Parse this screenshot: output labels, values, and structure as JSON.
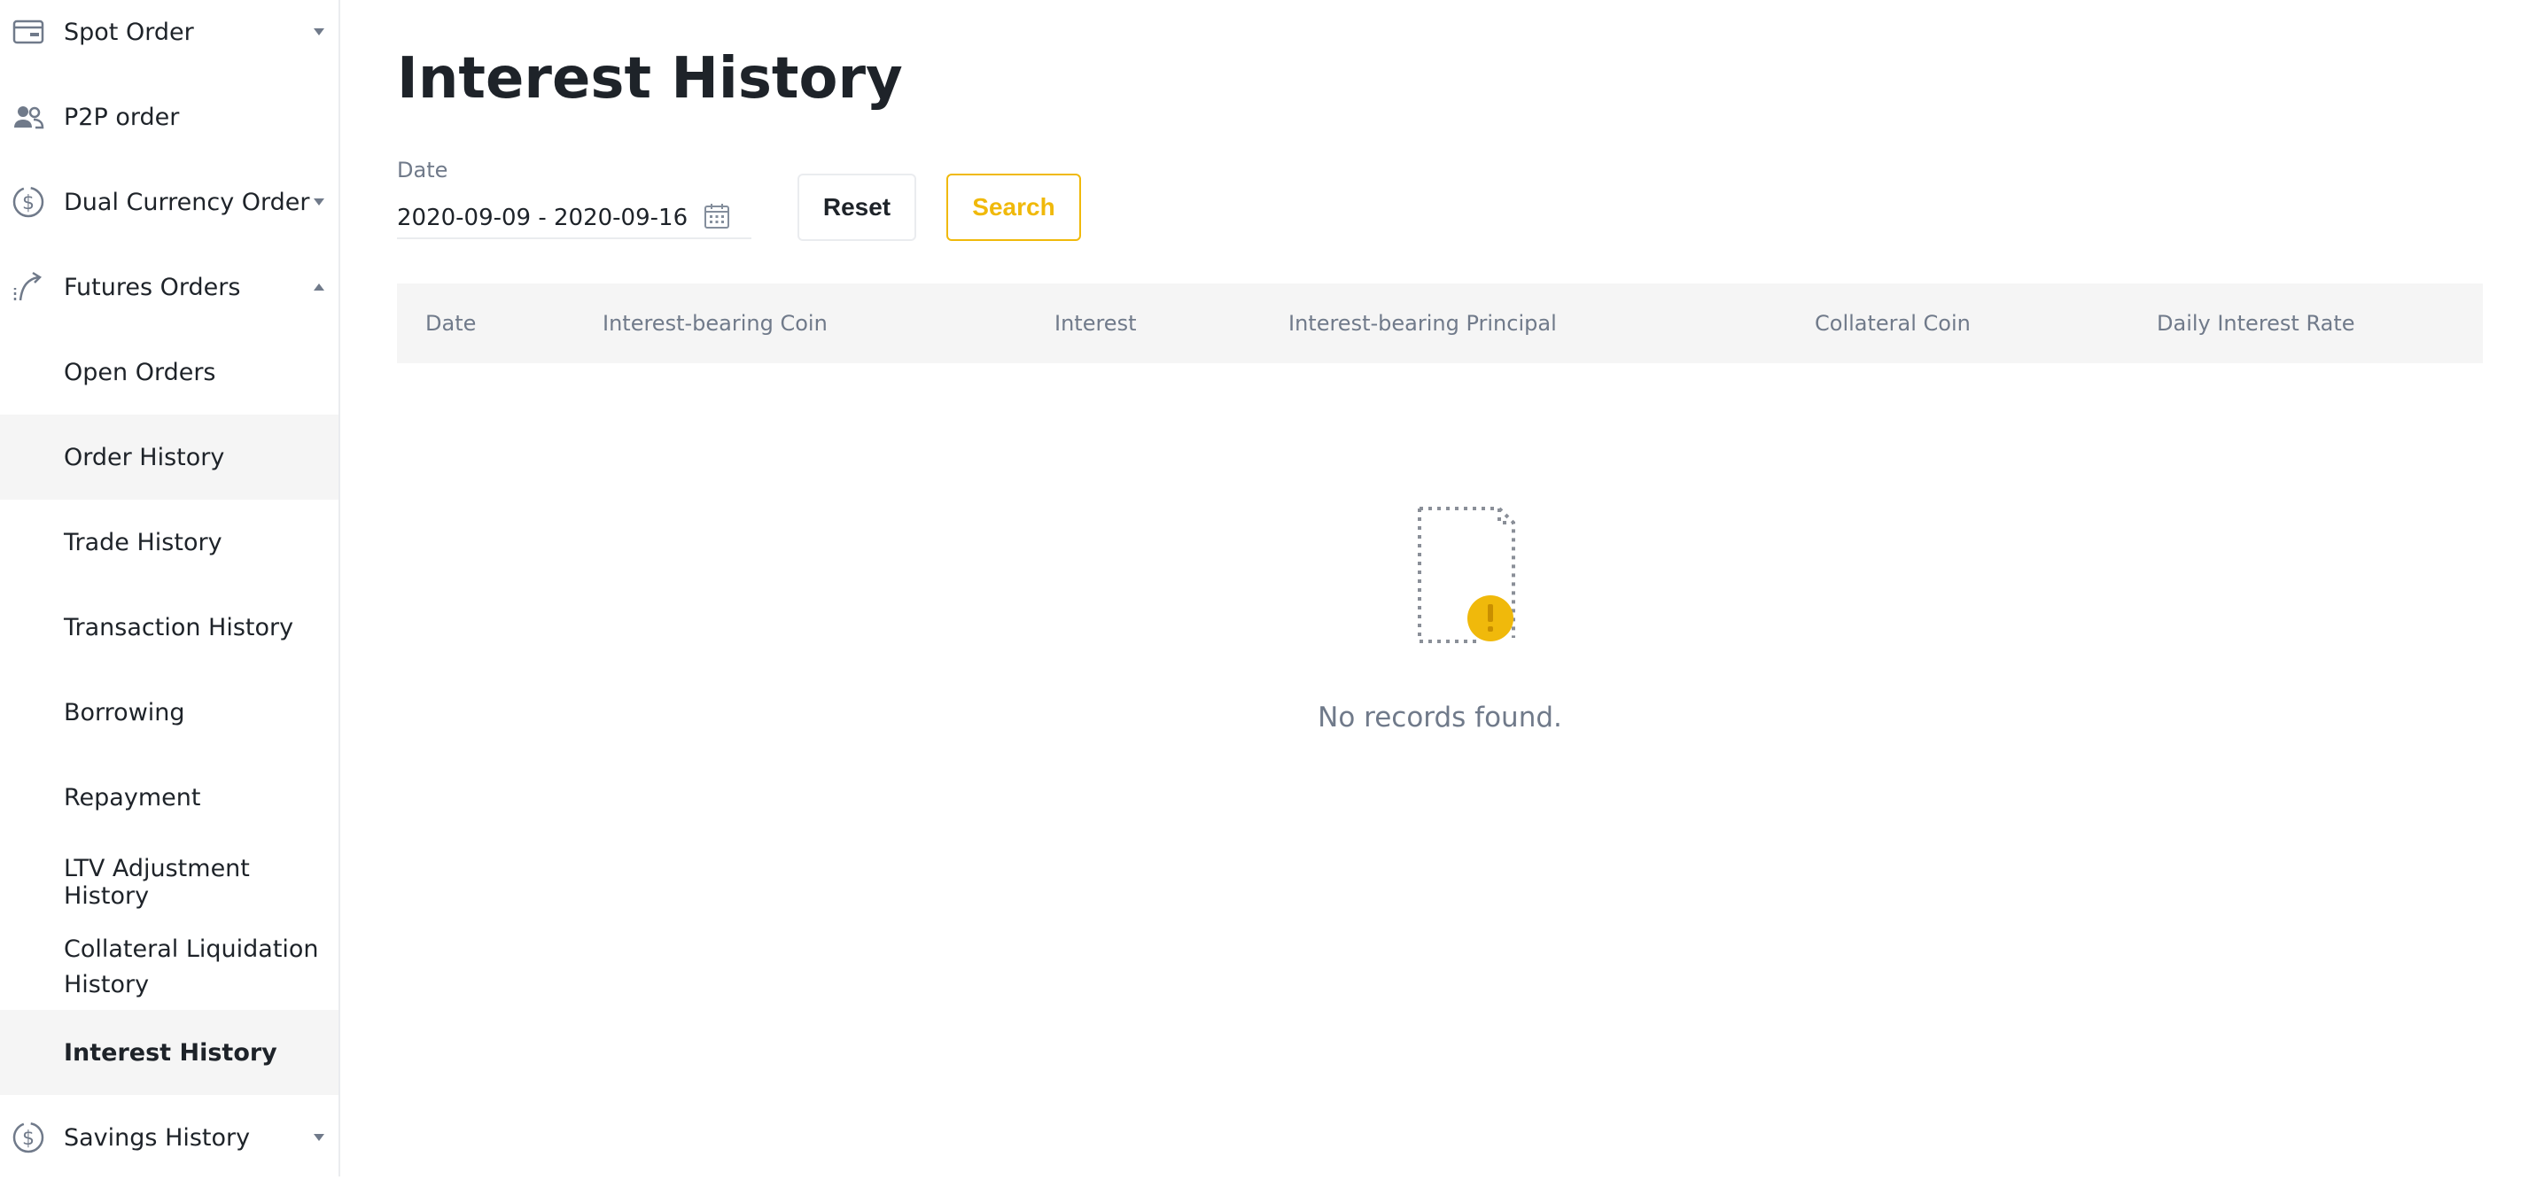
{
  "sidebar": {
    "items": [
      {
        "label": "Spot Order",
        "icon": "wallet-card-icon"
      },
      {
        "label": "P2P order",
        "icon": "users-icon"
      },
      {
        "label": "Dual Currency Order",
        "icon": "dollar-circle-icon"
      },
      {
        "label": "Futures Orders",
        "icon": "futures-arrow-icon"
      },
      {
        "label": "Open Orders"
      },
      {
        "label": "Order History"
      },
      {
        "label": "Trade History"
      },
      {
        "label": "Transaction History"
      },
      {
        "label": "Borrowing"
      },
      {
        "label": "Repayment"
      },
      {
        "label": "LTV Adjustment History"
      },
      {
        "label": "Collateral Liquidation History"
      },
      {
        "label": "Interest History"
      },
      {
        "label": "Savings History",
        "icon": "dollar-circle-icon"
      }
    ]
  },
  "main": {
    "title": "Interest History",
    "filter": {
      "date_label": "Date",
      "date_value": "2020-09-09 - 2020-09-16",
      "reset_label": "Reset",
      "search_label": "Search"
    },
    "table": {
      "columns": [
        "Date",
        "Interest-bearing Coin",
        "Interest",
        "Interest-bearing Principal",
        "Collateral Coin",
        "Daily Interest Rate"
      ]
    },
    "empty": {
      "message": "No records found.",
      "icon": "empty-document-warning-icon"
    }
  },
  "colors": {
    "accent": "#f0b90b",
    "text_primary": "#1e2329",
    "text_secondary": "#707a8a",
    "active_bg": "#f5f5f5"
  }
}
